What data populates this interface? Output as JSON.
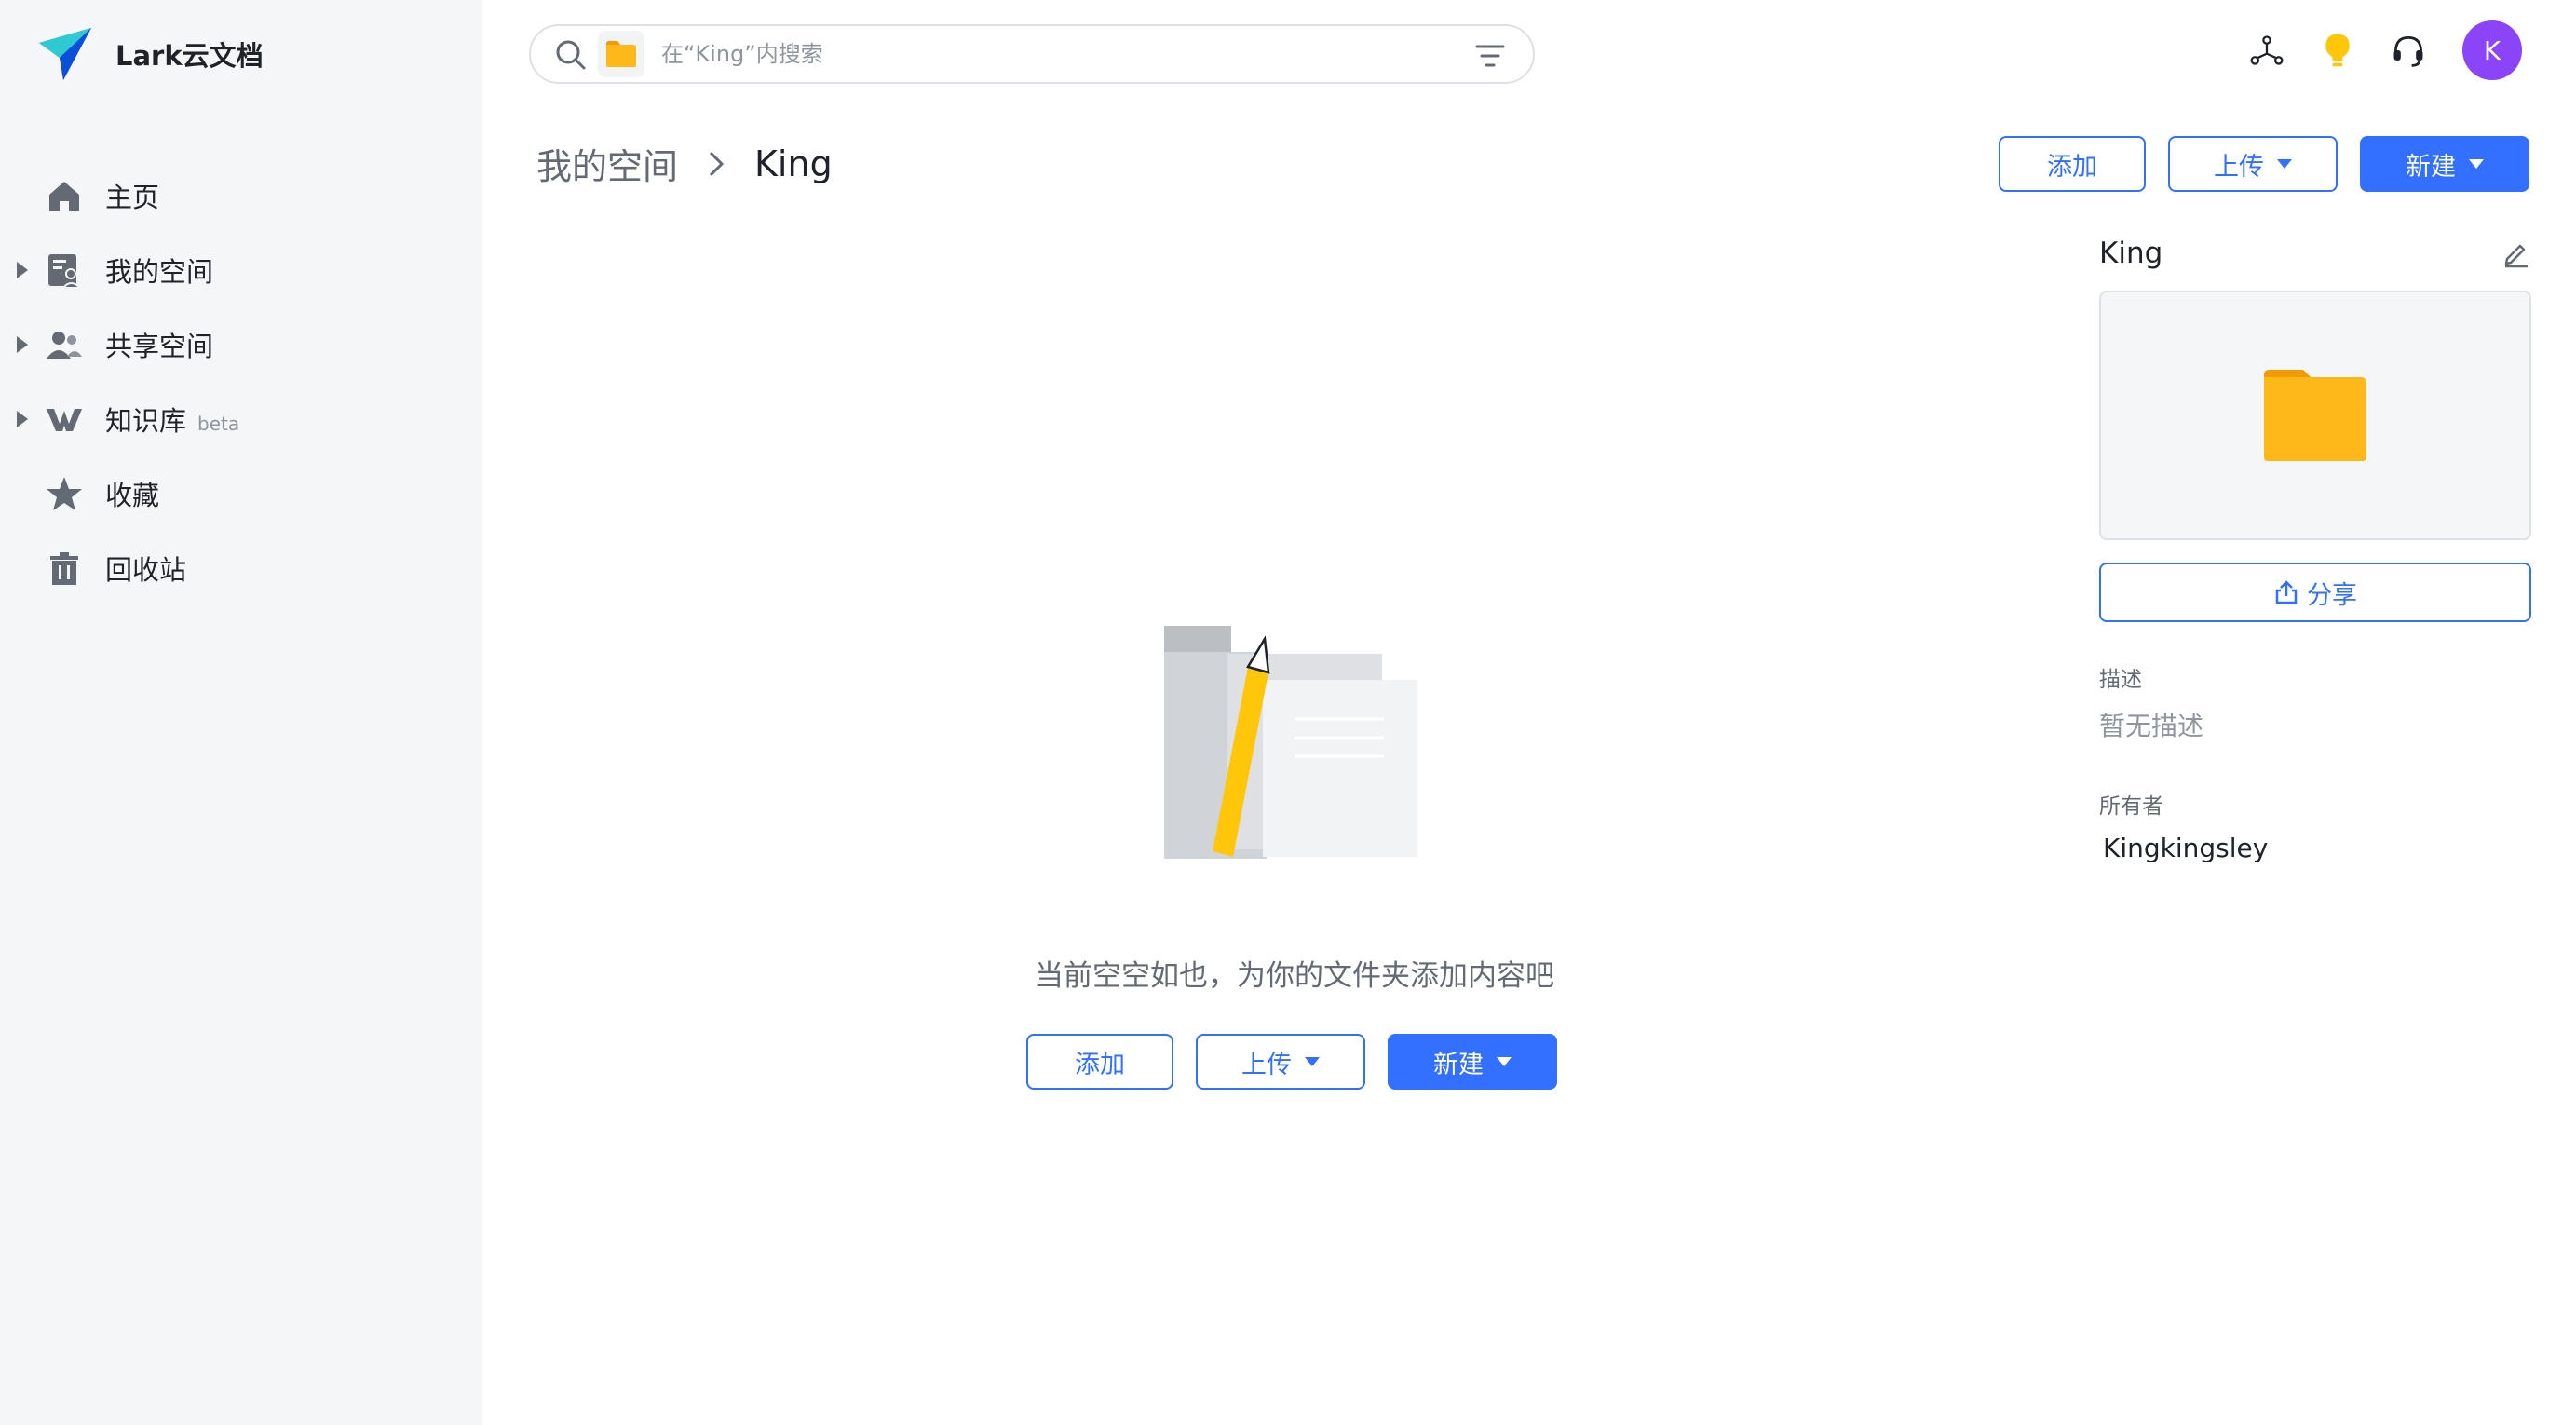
{
  "app": {
    "title": "Lark云文档"
  },
  "sidebar": {
    "items": [
      {
        "label": "主页",
        "icon": "home-icon",
        "expandable": false
      },
      {
        "label": "我的空间",
        "icon": "my-space-icon",
        "expandable": true
      },
      {
        "label": "共享空间",
        "icon": "shared-space-icon",
        "expandable": true
      },
      {
        "label": "知识库",
        "badge": "beta",
        "icon": "wiki-icon",
        "expandable": true
      },
      {
        "label": "收藏",
        "icon": "star-icon",
        "expandable": false
      },
      {
        "label": "回收站",
        "icon": "trash-icon",
        "expandable": false
      }
    ]
  },
  "search": {
    "placeholder": "在“King”内搜索",
    "value": ""
  },
  "header": {
    "avatar_initial": "K",
    "icons": [
      "network-icon",
      "bulb-icon",
      "headset-icon"
    ]
  },
  "breadcrumb": {
    "root": "我的空间",
    "current": "King"
  },
  "toolbar": {
    "add_label": "添加",
    "upload_label": "上传",
    "new_label": "新建"
  },
  "empty_state": {
    "message": "当前空空如也，为你的文件夹添加内容吧",
    "add_label": "添加",
    "upload_label": "上传",
    "new_label": "新建"
  },
  "panel": {
    "title": "King",
    "share_label": "分享",
    "description_label": "描述",
    "description_value": "暂无描述",
    "owner_label": "所有者",
    "owner_value": "Kingkingsley"
  },
  "colors": {
    "accent": "#3370ff",
    "folder": "#ffb819",
    "avatar": "#8b44f7",
    "sidebar_bg": "#f5f6f7"
  }
}
